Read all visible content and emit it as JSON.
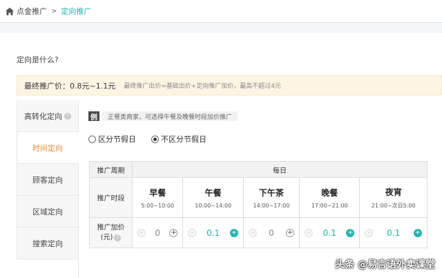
{
  "breadcrumb": {
    "root": "点金推广",
    "separator": ">",
    "current": "定向推广"
  },
  "question": "定向是什么?",
  "price_banner": {
    "label": "最终推广价：0.8元~1.1元",
    "note": "最终推广出价=基础出价+定向推广加价，最高不超过4元"
  },
  "tabs": [
    {
      "label": "高转化定向",
      "help": "?"
    },
    {
      "label": "时间定向"
    },
    {
      "label": "顾客定向"
    },
    {
      "label": "区域定向"
    },
    {
      "label": "搜索定向"
    }
  ],
  "example": {
    "badge": "例",
    "text": "正餐类商家，可选择午餐及晚餐时段加价推广"
  },
  "radios": [
    {
      "label": "区分节假日",
      "checked": false
    },
    {
      "label": "不区分节假日",
      "checked": true
    }
  ],
  "table": {
    "period_header": "推广周期",
    "daily_header": "每日",
    "slot_label": "推广时段",
    "price_label_1": "推广加价",
    "price_label_2": "(元)",
    "help": "?",
    "slots": [
      {
        "name": "早餐",
        "time": "5:00~10:00",
        "value": "0",
        "minus": "-",
        "plus": "+"
      },
      {
        "name": "午餐",
        "time": "10:00~14:00",
        "value": "0.1",
        "minus": "-",
        "plus": "+"
      },
      {
        "name": "下午茶",
        "time": "14:00~17:00",
        "value": "0",
        "minus": "-",
        "plus": "+"
      },
      {
        "name": "晚餐",
        "time": "17:00~21:00",
        "value": "0.1",
        "minus": "-",
        "plus": "+"
      },
      {
        "name": "夜宵",
        "time": "21:00~次日5:00",
        "value": "0.1",
        "minus": "-",
        "plus": "+"
      }
    ]
  },
  "watermark": "头条 @易言语外卖课堂",
  "colors": {
    "accent": "#1fb5ac",
    "active_tab": "#e78a3a",
    "banner_bg": "#fdf5e4"
  }
}
